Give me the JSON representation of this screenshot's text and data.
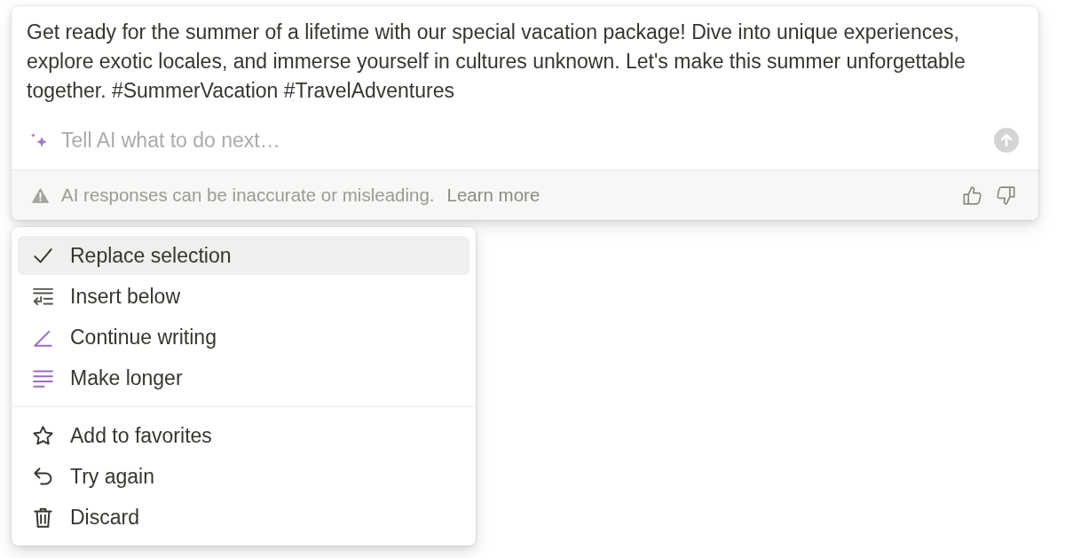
{
  "response": {
    "text": "Get ready for the summer of a lifetime with our special vacation package! Dive into unique experiences, explore exotic locales, and immerse yourself in cultures unknown. Let's make this summer unforgettable together. #SummerVacation #TravelAdventures"
  },
  "prompt": {
    "placeholder": "Tell AI what to do next…"
  },
  "send_button": {
    "disabled": true
  },
  "footer": {
    "notice": "AI responses can be inaccurate or misleading.",
    "link": "Learn more"
  },
  "menu": {
    "groups": [
      {
        "items": [
          {
            "label": "Replace selection",
            "selected": true
          },
          {
            "label": "Insert below",
            "selected": false
          },
          {
            "label": "Continue writing",
            "selected": false
          },
          {
            "label": "Make longer",
            "selected": false
          }
        ]
      },
      {
        "items": [
          {
            "label": "Add to favorites",
            "selected": false
          },
          {
            "label": "Try again",
            "selected": false
          },
          {
            "label": "Discard",
            "selected": false
          }
        ]
      }
    ]
  }
}
